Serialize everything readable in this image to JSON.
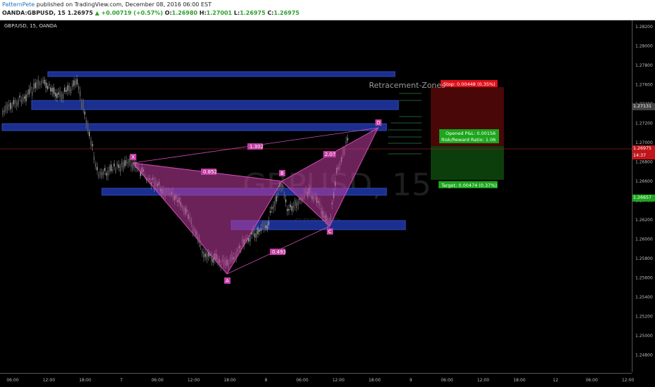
{
  "header": {
    "author": "PatternPete",
    "published": "published on TradingView.com, December 08, 2016 06:00 EST",
    "symbol": "OANDA:GBPUSD, 15",
    "price": "1.26975",
    "change": "+0.00719 (+0.57%)",
    "o_label": "O:",
    "o_value": "1.26980",
    "h_label": "H:",
    "h_value": "1.27001",
    "l_label": "L:",
    "l_value": "1.26975",
    "c_label": "C:",
    "c_value": "1.26975"
  },
  "chart": {
    "title": "GBP/USD, 15, OANDA",
    "watermark": "GBPUSD, 15",
    "watermark_sub": "GBPUSD",
    "annotation_title": "Retracement-Zones",
    "stop_label": "Stop: 0.00448 (0.35%)",
    "pnl_label": "Opened P&L: 0.00156",
    "rr_label": "Risk/Reward Ratio: 1.06",
    "target_label": "Target: 0.00474 (0.37%)",
    "points": {
      "X": "X",
      "A": "A",
      "B": "B",
      "C": "C",
      "D": "D"
    },
    "ratios": {
      "xb": "0.852",
      "ac": "0.493",
      "xd": "1.302",
      "bd": "2.07"
    },
    "y_ticks": [
      "1.28200",
      "1.28000",
      "1.27800",
      "1.27600",
      "1.27400",
      "1.27200",
      "1.27000",
      "1.26800",
      "1.26600",
      "1.26400",
      "1.26200",
      "1.26000",
      "1.25800",
      "1.25600",
      "1.25400",
      "1.25200",
      "1.25000",
      "1.24800"
    ],
    "x_ticks": [
      "06:00",
      "12:00",
      "18:00",
      "7",
      "06:00",
      "12:00",
      "18:00",
      "8",
      "06:00",
      "12:00",
      "18:00",
      "9",
      "06:00",
      "12:00",
      "18:00",
      "12",
      "06:00",
      "12:00"
    ],
    "price_badges": {
      "p1": "1.27131",
      "p2": "1.26975",
      "p3": "14:37",
      "p4": "1.26657"
    },
    "colors": {
      "zone": "#1a2f8f",
      "pattern": "#c33ea3",
      "stop": "#e0101a",
      "target": "#1ca61c",
      "candle": "#7a7a7a"
    }
  }
}
